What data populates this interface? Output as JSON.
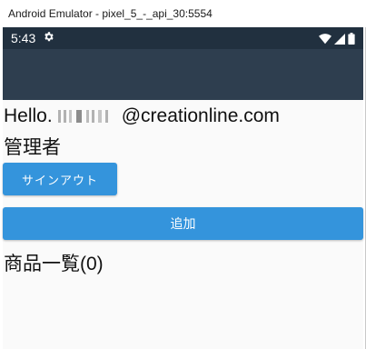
{
  "window": {
    "title": "Android Emulator - pixel_5_-_api_30:5554"
  },
  "status_bar": {
    "time": "5:43",
    "icons": [
      "gear-icon",
      "wifi-icon",
      "signal-icon",
      "battery-icon"
    ],
    "background": "#21303f"
  },
  "app_bar": {
    "background": "#2e3e4f"
  },
  "main": {
    "greeting_prefix": "Hello.",
    "email_domain": "@creationline.com",
    "role": "管理者",
    "signout_label": "サインアウト",
    "add_label": "追加",
    "product_list_heading": "商品一覧(0)",
    "button_color": "#3494dc"
  }
}
